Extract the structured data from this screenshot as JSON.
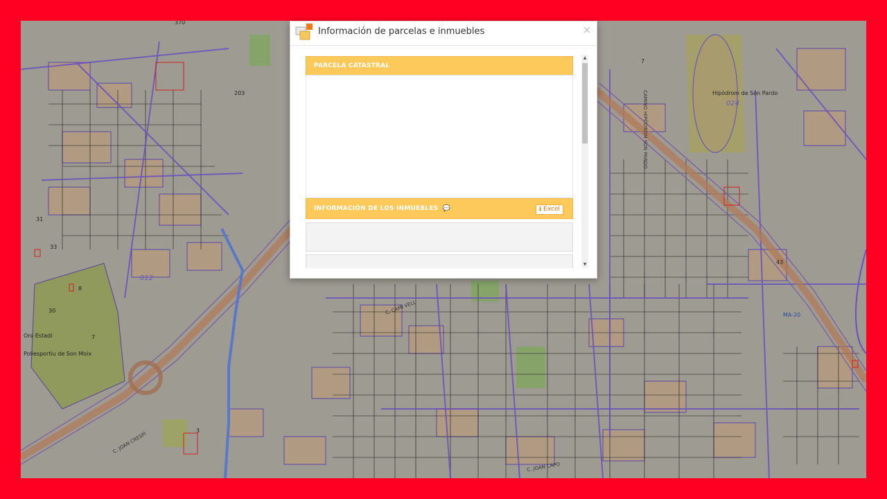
{
  "dialog": {
    "title": "Información de parcelas e inmuebles",
    "close_label": "×",
    "icon": "parcel-stack-icon",
    "section_parcel_title": "PARCELA CATASTRAL",
    "section_properties_title": "INFORMACIÓN DE LOS INMUEBLES",
    "comment_icon": "💬",
    "excel_label": "Excel",
    "excel_icon": "download-icon"
  },
  "scrollbar": {
    "up": "▲",
    "down": "▼"
  },
  "colors": {
    "frame_border": "#ff0022",
    "panel_header": "#fdc95a",
    "excel_text": "#e07a10"
  },
  "map": {
    "labels": {
      "hippodrome": "Hipòdrom de Son Pardo",
      "zone_024": "024",
      "zone_012": "012",
      "street_hipodrom": "CAMINO HIPÒDROM SON PARDO",
      "street_cami_vell": "C. CAMÍ VELL",
      "street_joan_capo": "C. JOAN CAPO",
      "street_joan_crespi": "C. JOAN CRESPÍ",
      "stadium": "Oro Estadi",
      "sports": "Poliesportiu de Son Moix",
      "ma20": "MA-20",
      "n370": "370",
      "n7a": "7",
      "n7b": "7",
      "n8": "8",
      "n30": "30",
      "n31": "31",
      "n33": "33",
      "n43": "43",
      "n3": "3",
      "n203": "203"
    }
  }
}
